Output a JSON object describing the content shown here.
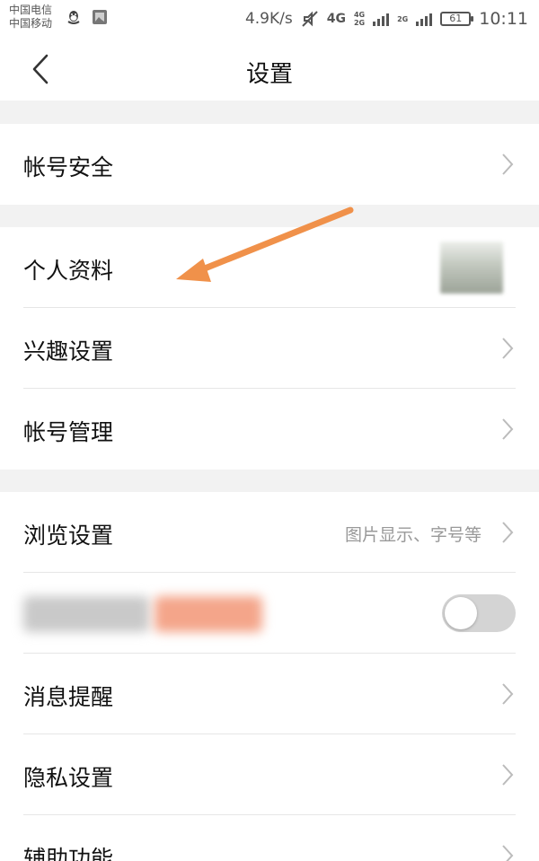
{
  "status_bar": {
    "carrier_1": "中国电信",
    "carrier_2": "中国移动",
    "net_speed": "4.9K/s",
    "network_4g": "4G",
    "network_4g_small": "4G",
    "network_2g_small": "2G",
    "network_2g": "2G",
    "battery": "61",
    "time": "10:11"
  },
  "header": {
    "title": "设置"
  },
  "groups": [
    {
      "items": [
        {
          "label": "帐号安全"
        }
      ]
    },
    {
      "items": [
        {
          "label": "个人资料"
        },
        {
          "label": "兴趣设置"
        },
        {
          "label": "帐号管理"
        }
      ]
    },
    {
      "items": [
        {
          "label": "浏览设置",
          "hint": "图片显示、字号等"
        },
        {
          "label": "",
          "toggle_on": false
        },
        {
          "label": "消息提醒"
        },
        {
          "label": "隐私设置"
        },
        {
          "label": "辅助功能"
        }
      ]
    }
  ],
  "colors": {
    "annotation_arrow": "#f0914a",
    "toggle_off": "#d4d4d4"
  }
}
